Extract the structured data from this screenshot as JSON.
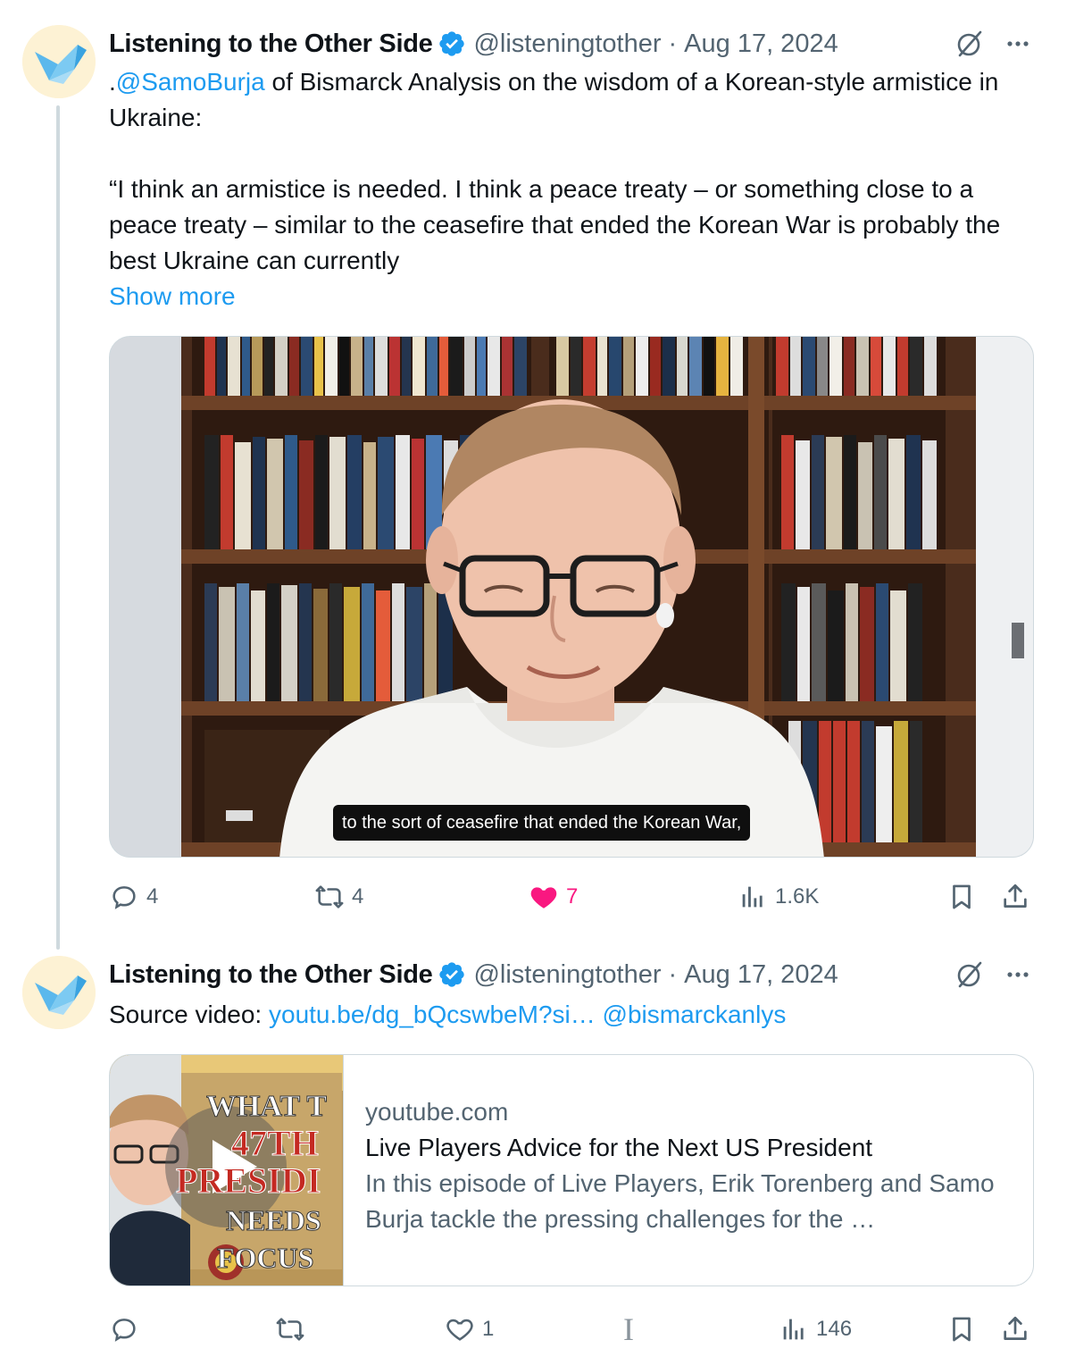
{
  "tweets": [
    {
      "author_name": "Listening to the Other Side",
      "handle": "@listeningtother",
      "separator": "·",
      "date": "Aug 17, 2024",
      "text_mention": "@SamoBurja",
      "text_prefix": ".",
      "text_line1_rest": " of Bismarck Analysis on the wisdom of a Korean-style armistice in Ukraine:",
      "text_quote": "“I think an armistice is needed. I think a peace treaty – or something close to a peace treaty – similar to the ceasefire that ended the Korean War is probably the best Ukraine can currently",
      "show_more": "Show more",
      "video_caption": "to the sort of ceasefire that ended the Korean War,",
      "actions": {
        "replies": "4",
        "reposts": "4",
        "likes": "7",
        "views": "1.6K"
      }
    },
    {
      "author_name": "Listening to the Other Side",
      "handle": "@listeningtother",
      "separator": "·",
      "date": "Aug 17, 2024",
      "text_prefix": "Source video: ",
      "text_link": "youtu.be/dg_bQcswbeM?si…",
      "text_mention": "@bismarckanlys",
      "card": {
        "domain": "youtube.com",
        "title": "Live Players Advice for the Next US President",
        "description": "In this episode of Live Players, Erik Torenberg and Samo Burja tackle the pressing challenges for the …",
        "thumb_lines": [
          "WHAT T",
          "47TH",
          "PRESIDI",
          "NEEDS",
          "FOCUS"
        ]
      },
      "actions": {
        "replies": "",
        "reposts": "",
        "likes": "1",
        "cursor": "I",
        "views": "146"
      }
    }
  ],
  "colors": {
    "link": "#1d9bf0",
    "muted": "#536471",
    "like": "#f91880",
    "verified": "#1d9bf0"
  },
  "icons": [
    "avatar-bird-icon",
    "verified-badge-icon",
    "grok-icon",
    "more-icon",
    "reply-icon",
    "repost-icon",
    "like-icon",
    "views-icon",
    "bookmark-icon",
    "share-icon",
    "play-icon"
  ]
}
